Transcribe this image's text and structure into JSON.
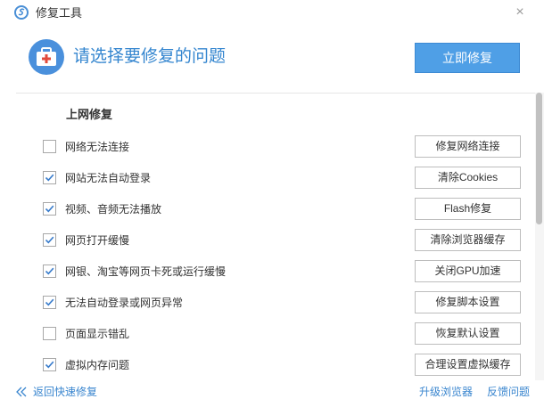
{
  "window": {
    "title": "修复工具",
    "close_symbol": "×"
  },
  "header": {
    "title": "请选择要修复的问题",
    "repair_button": "立即修复"
  },
  "section": {
    "title": "上网修复"
  },
  "items": [
    {
      "label": "网络无法连接",
      "checked": false,
      "action": "修复网络连接"
    },
    {
      "label": "网站无法自动登录",
      "checked": true,
      "action": "清除Cookies"
    },
    {
      "label": "视频、音频无法播放",
      "checked": true,
      "action": "Flash修复"
    },
    {
      "label": "网页打开缓慢",
      "checked": true,
      "action": "清除浏览器缓存"
    },
    {
      "label": "网银、淘宝等网页卡死或运行缓慢",
      "checked": true,
      "action": "关闭GPU加速"
    },
    {
      "label": "无法自动登录或网页异常",
      "checked": true,
      "action": "修复脚本设置"
    },
    {
      "label": "页面显示错乱",
      "checked": false,
      "action": "恢复默认设置"
    },
    {
      "label": "虚拟内存问题",
      "checked": true,
      "action": "合理设置虚拟缓存"
    }
  ],
  "footer": {
    "back": "返回快速修复",
    "upgrade": "升级浏览器",
    "feedback": "反馈问题"
  },
  "colors": {
    "accent": "#3385cf",
    "button_bg": "#4f9fe6",
    "check": "#3a7dcc",
    "kit_red": "#e24a3b"
  }
}
